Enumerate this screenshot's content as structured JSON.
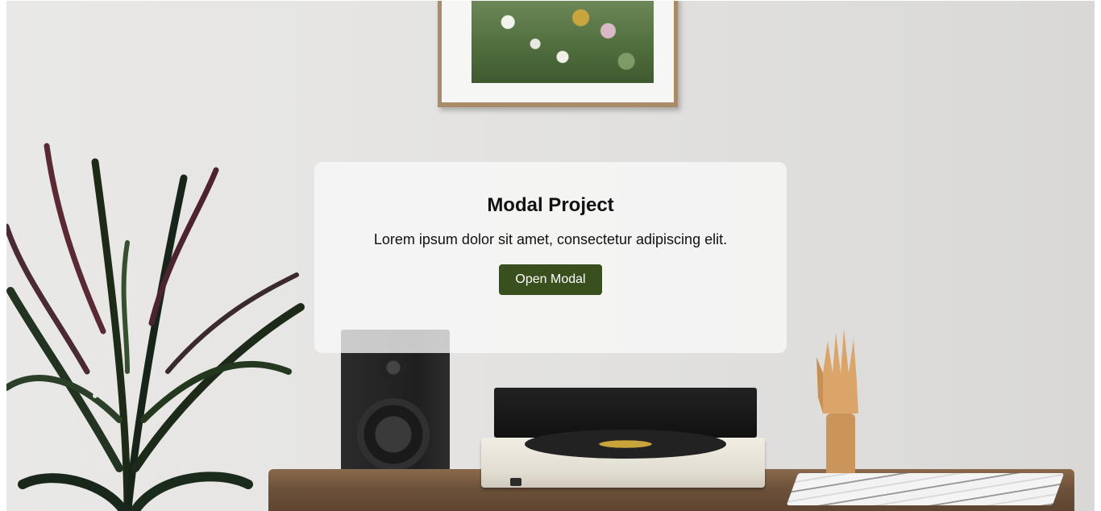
{
  "card": {
    "title": "Modal Project",
    "description": "Lorem ipsum dolor sit amet, consectetur adipiscing elit.",
    "button_label": "Open Modal"
  },
  "colors": {
    "button_background": "#3a4f1e",
    "button_text": "#ffffff",
    "card_background": "#f8f8f8",
    "text": "#111111"
  }
}
